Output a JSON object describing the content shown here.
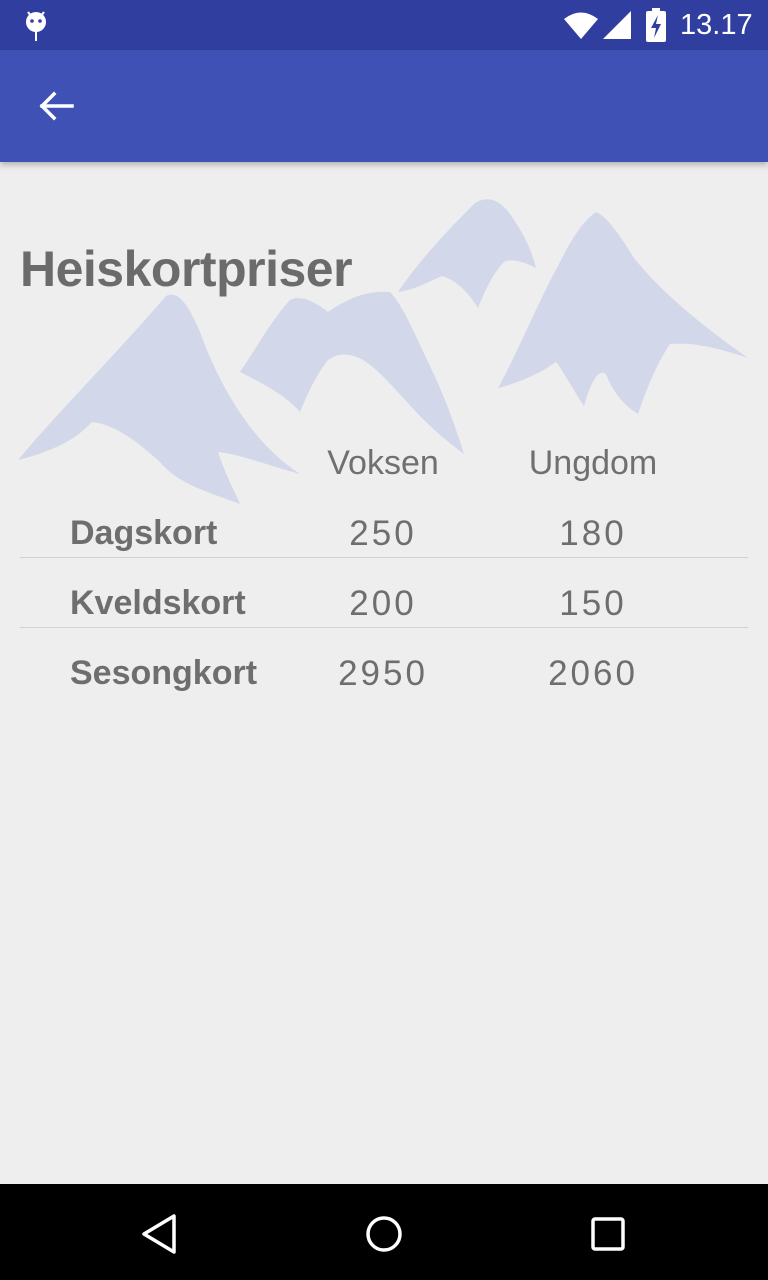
{
  "status_bar": {
    "time": "13.17",
    "icons": [
      "android-debug-icon",
      "wifi-icon",
      "cell-signal-icon",
      "battery-charging-icon"
    ]
  },
  "app_bar": {
    "back_icon": "arrow-back-icon",
    "color": "#3f51b5"
  },
  "page": {
    "title": "Heiskortpriser",
    "background_image": "mountains-illustration"
  },
  "price_table": {
    "columns": [
      "Voksen",
      "Ungdom"
    ],
    "rows": [
      {
        "label": "Dagskort",
        "values": [
          "250",
          "180"
        ]
      },
      {
        "label": "Kveldskort",
        "values": [
          "200",
          "150"
        ]
      },
      {
        "label": "Sesongkort",
        "values": [
          "2950",
          "2060"
        ]
      }
    ]
  },
  "nav_bar": {
    "buttons": [
      "back-triangle-icon",
      "home-circle-icon",
      "recents-square-icon"
    ]
  },
  "colors": {
    "status_bar": "#303f9f",
    "app_bar": "#3f51b5",
    "background": "#eeeeee",
    "text": "#6e6e6e",
    "mountain_tint": "#d2d7ea"
  }
}
